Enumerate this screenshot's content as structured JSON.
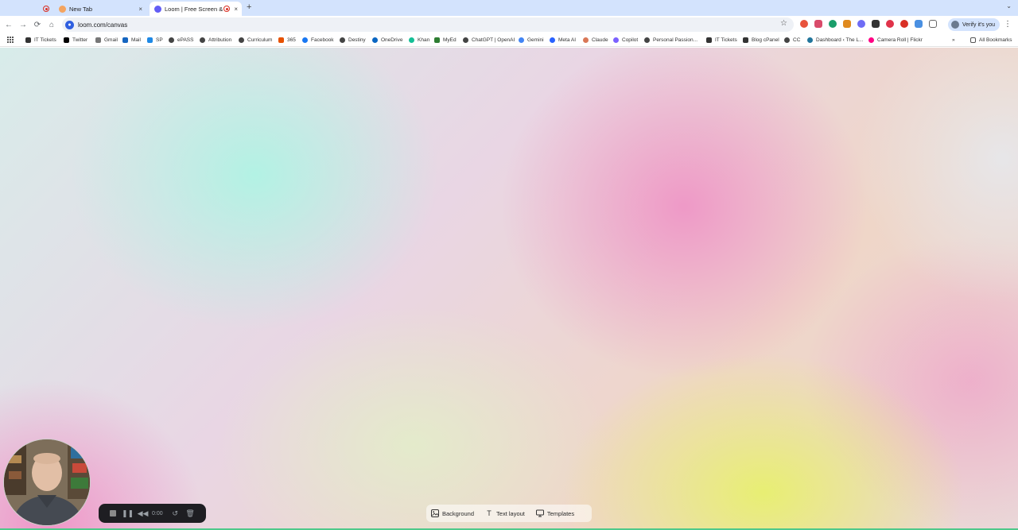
{
  "browser": {
    "tabs": [
      {
        "title": "",
        "active": false
      },
      {
        "title": "New Tab",
        "active": false
      },
      {
        "title": "Loom | Free Screen & Vide",
        "active": true
      }
    ],
    "new_tab_symbol": "+",
    "tab_menu_symbol": "⌄",
    "url": "loom.com/canvas",
    "verify_label": "Verify it's you",
    "icons": {
      "back": "←",
      "forward": "→",
      "reload": "⟳",
      "home": "⌂",
      "star": "☆",
      "kebab": "⋮",
      "close": "×",
      "chevron": "»"
    },
    "colors": {
      "tab_strip": "#d3e3fd",
      "recording_red": "#d93025",
      "loom_blue": "#2f5fe0"
    }
  },
  "bookmarks": [
    {
      "label": "IT Tickets",
      "color": "#333333"
    },
    {
      "label": "Twitter",
      "color": "#000000"
    },
    {
      "label": "Gmail",
      "color": "#555555"
    },
    {
      "label": "Mail",
      "color": "#1565c0"
    },
    {
      "label": "SP",
      "color": "#1e88e5"
    },
    {
      "label": "ePASS",
      "color": "#444444"
    },
    {
      "label": "Attribution",
      "color": "#444444"
    },
    {
      "label": "Curriculum",
      "color": "#444444"
    },
    {
      "label": "365",
      "color": "#e65100"
    },
    {
      "label": "Facebook",
      "color": "#1877f2"
    },
    {
      "label": "Destiny",
      "color": "#444444"
    },
    {
      "label": "OneDrive",
      "color": "#0a66c2"
    },
    {
      "label": "Khan",
      "color": "#14bf96"
    },
    {
      "label": "MyEd",
      "color": "#2e7d32"
    },
    {
      "label": "ChatGPT | OpenAI",
      "color": "#444444"
    },
    {
      "label": "Gemini",
      "color": "#4285f4"
    },
    {
      "label": "Meta AI",
      "color": "#2962ff"
    },
    {
      "label": "Claude",
      "color": "#d97757"
    },
    {
      "label": "Copilot",
      "color": "#7b61ff"
    },
    {
      "label": "Personal Passion...",
      "color": "#444444"
    },
    {
      "label": "IT Tickets",
      "color": "#333333"
    },
    {
      "label": "Blog cPanel",
      "color": "#333333"
    },
    {
      "label": "CC",
      "color": "#444444"
    },
    {
      "label": "Dashboard ‹ The L...",
      "color": "#21759b"
    },
    {
      "label": "Camera Roll | Flickr",
      "color": "#ff0084"
    }
  ],
  "bookmarks_overflow": "»",
  "all_bookmarks_label": "All Bookmarks",
  "recorder": {
    "time": "0:00"
  },
  "canvas_toolbar": {
    "background_label": "Background",
    "text_layout_label": "Text layout",
    "templates_label": "Templates"
  }
}
